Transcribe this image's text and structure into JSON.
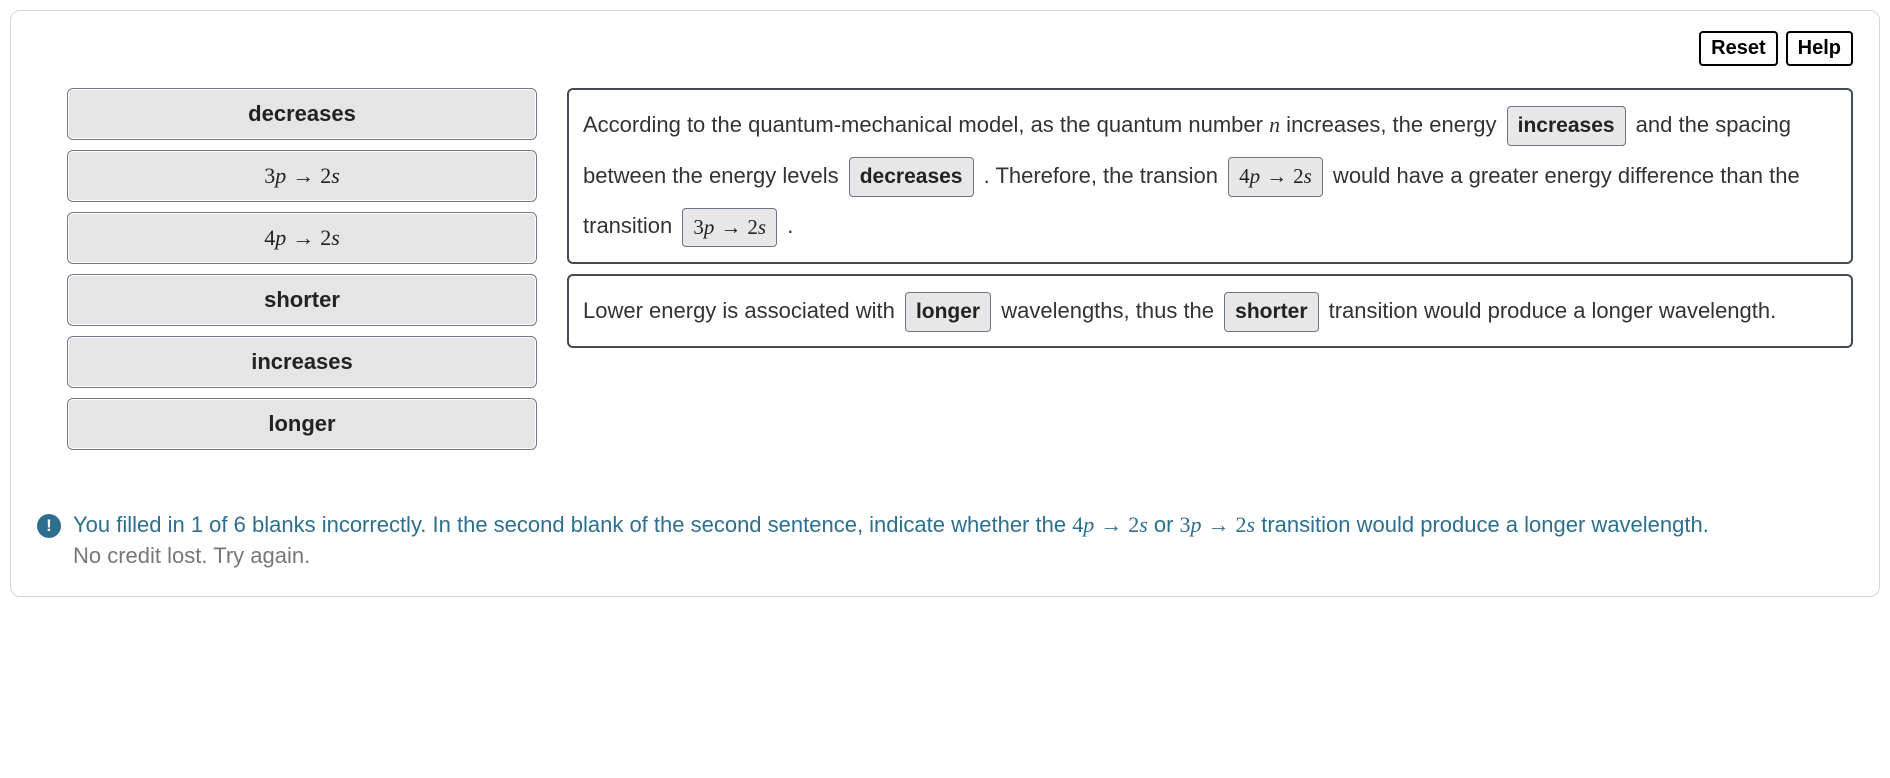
{
  "toolbar": {
    "reset_label": "Reset",
    "help_label": "Help"
  },
  "bank": {
    "items": [
      {
        "kind": "word",
        "text": "decreases"
      },
      {
        "kind": "trans",
        "from_n": "3",
        "from_l": "p",
        "to_n": "2",
        "to_l": "s"
      },
      {
        "kind": "trans",
        "from_n": "4",
        "from_l": "p",
        "to_n": "2",
        "to_l": "s"
      },
      {
        "kind": "word",
        "text": "shorter"
      },
      {
        "kind": "word",
        "text": "increases"
      },
      {
        "kind": "word",
        "text": "longer"
      }
    ]
  },
  "passage1": {
    "t1": "According to the quantum-mechanical model, as the quantum number ",
    "var_n": "n",
    "t2": " increases, the energy ",
    "blank1": "increases",
    "t3": " and the spacing between the energy levels ",
    "blank2": "decreases",
    "t4": " . Therefore, the transion ",
    "blank3": {
      "from_n": "4",
      "from_l": "p",
      "to_n": "2",
      "to_l": "s"
    },
    "t5": " would have a greater energy difference than the transition ",
    "blank4": {
      "from_n": "3",
      "from_l": "p",
      "to_n": "2",
      "to_l": "s"
    },
    "t6": " ."
  },
  "passage2": {
    "t1": "Lower energy is associated with ",
    "blank1": "longer",
    "t2": " wavelengths, thus the ",
    "blank2": "shorter",
    "t3": " transition would produce a longer wavelength."
  },
  "feedback": {
    "icon_glyph": "!",
    "l1a": "You filled in 1 of 6 blanks incorrectly. In the second blank of the second sentence, indicate whether the ",
    "m1": {
      "from_n": "4",
      "from_l": "p",
      "to_n": "2",
      "to_l": "s"
    },
    "l1b": " or ",
    "m2": {
      "from_n": "3",
      "from_l": "p",
      "to_n": "2",
      "to_l": "s"
    },
    "l1c": " transition would produce a longer wavelength.",
    "l2": "No credit lost. Try again."
  }
}
